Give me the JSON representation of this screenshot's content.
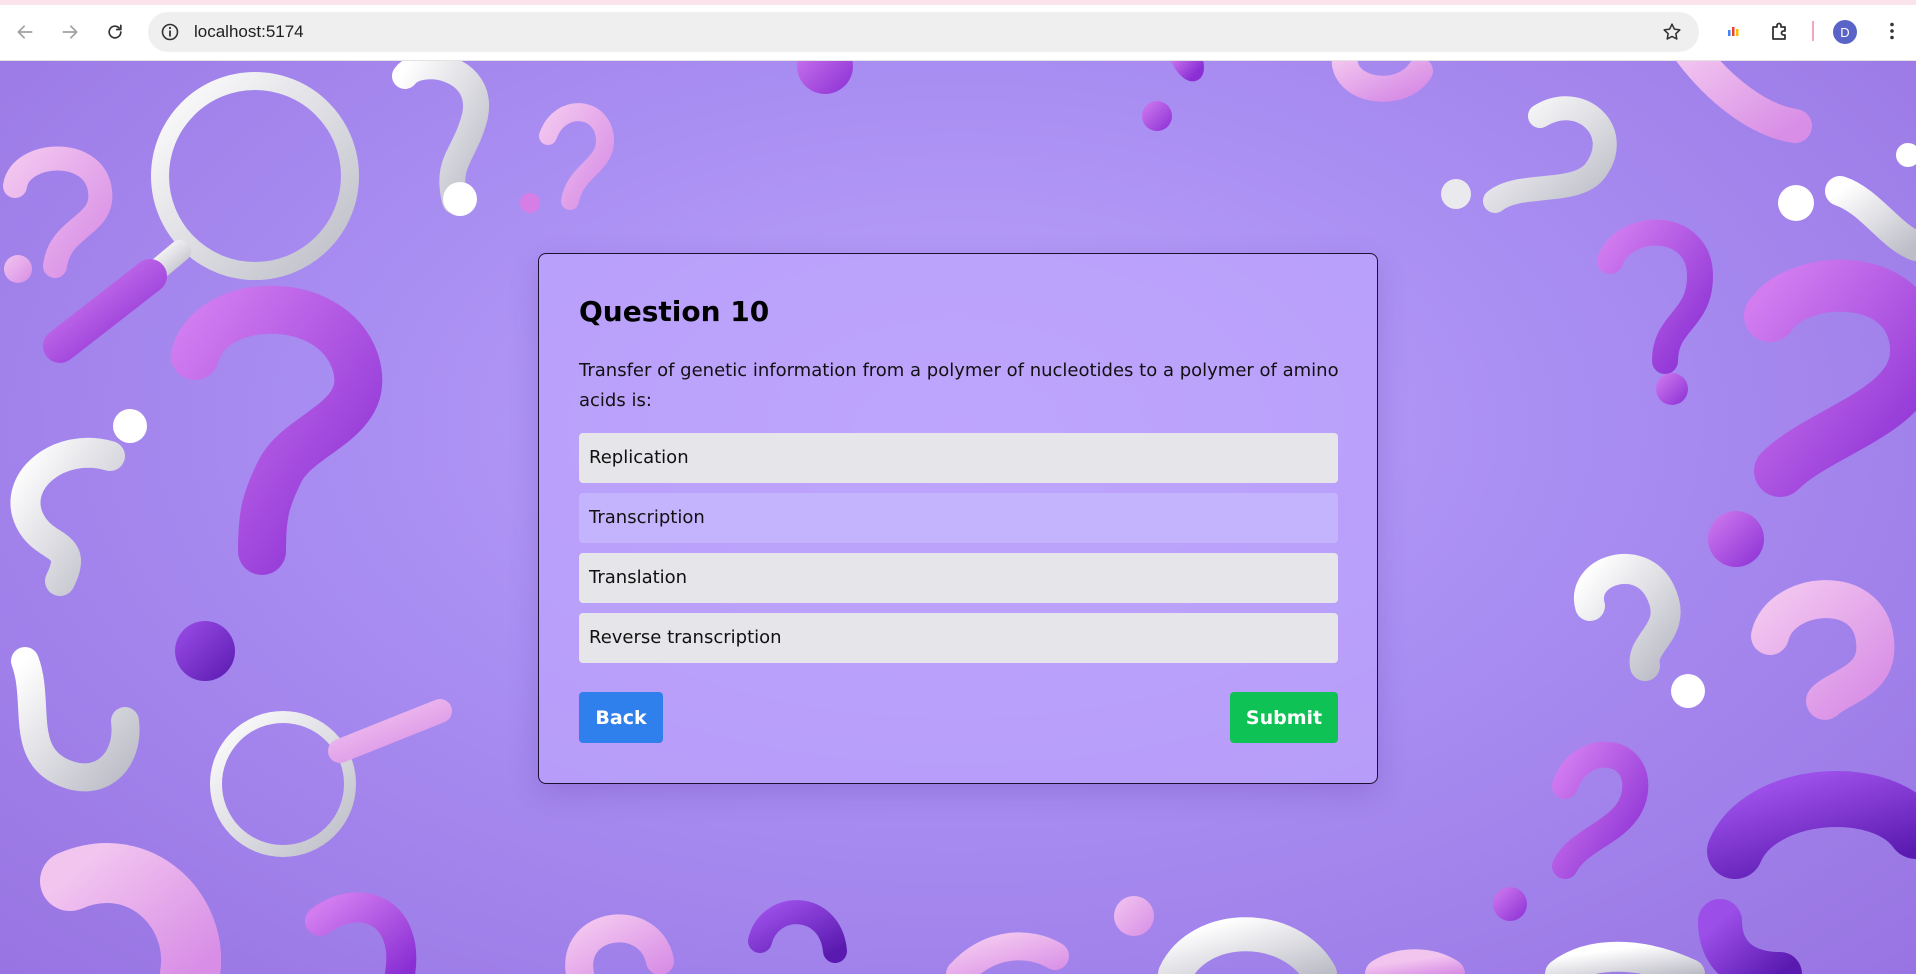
{
  "browser": {
    "url": "localhost:5174",
    "profile_initial": "D",
    "icons": {
      "back": "arrow-left-icon",
      "forward": "arrow-right-icon",
      "reload": "reload-icon",
      "site_info": "info-icon",
      "bookmark": "star-icon",
      "extension_1": "chart-extension-icon",
      "extensions": "puzzle-icon",
      "menu": "kebab-menu-icon"
    }
  },
  "quiz": {
    "title": "Question 10",
    "question": "Transfer of genetic information from a polymer of nucleotides to a polymer of amino acids is:",
    "options": [
      {
        "label": "Replication"
      },
      {
        "label": "Transcription"
      },
      {
        "label": "Translation"
      },
      {
        "label": "Reverse transcription"
      }
    ],
    "back_label": "Back",
    "submit_label": "Submit"
  },
  "colors": {
    "background": "#a98ef2",
    "card": "#bea5fc",
    "option": "#e5e5ea",
    "option_hover": "#c4b4fd",
    "back_button": "#2f80ed",
    "submit_button": "#0fc255"
  }
}
